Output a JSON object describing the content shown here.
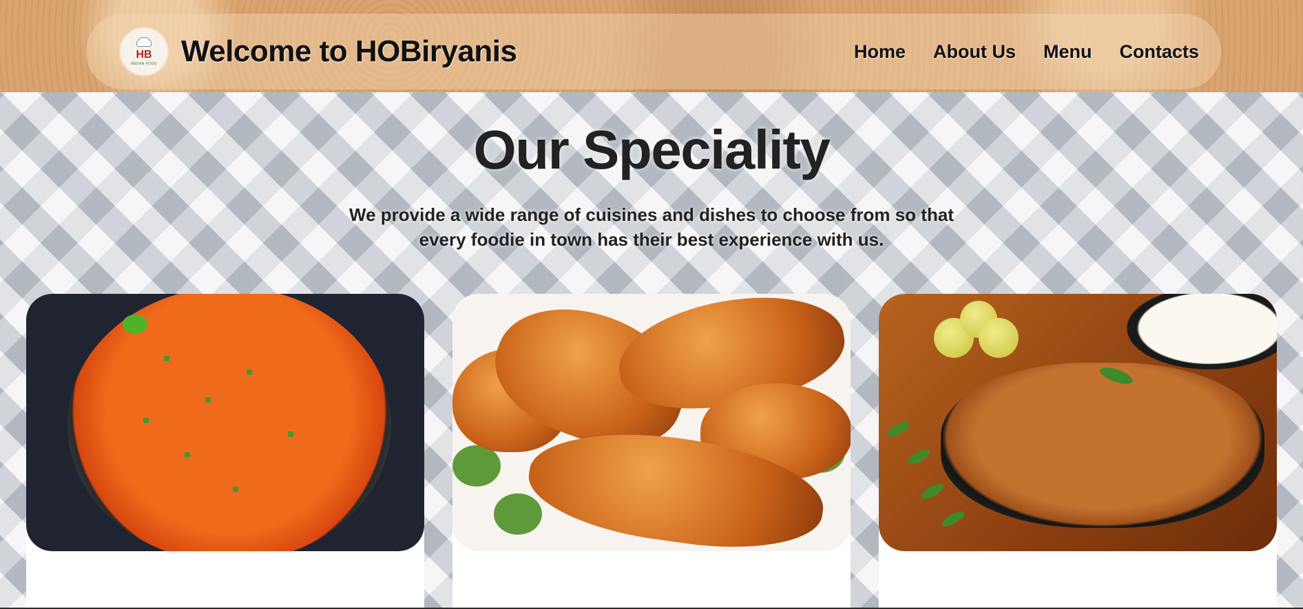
{
  "header": {
    "logo": {
      "mark": "HB",
      "sub": "INDIAN FOOD",
      "icon": "chef-logo-icon"
    },
    "title": "Welcome to HOBiryanis",
    "nav": [
      {
        "label": "Home"
      },
      {
        "label": "About Us"
      },
      {
        "label": "Menu"
      },
      {
        "label": "Contacts"
      }
    ]
  },
  "speciality": {
    "title": "Our Speciality",
    "description": "We provide a wide range of cuisines and dishes to choose from so that every foodie in town has their best experience with us.",
    "cards": [
      {
        "image": "chicken-curry-photo"
      },
      {
        "image": "grilled-chicken-legs-photo"
      },
      {
        "image": "chicken-masala-photo"
      }
    ]
  },
  "colors": {
    "header_bg": "#d9a46f",
    "text": "#111111",
    "card_bg": "#ffffff"
  }
}
